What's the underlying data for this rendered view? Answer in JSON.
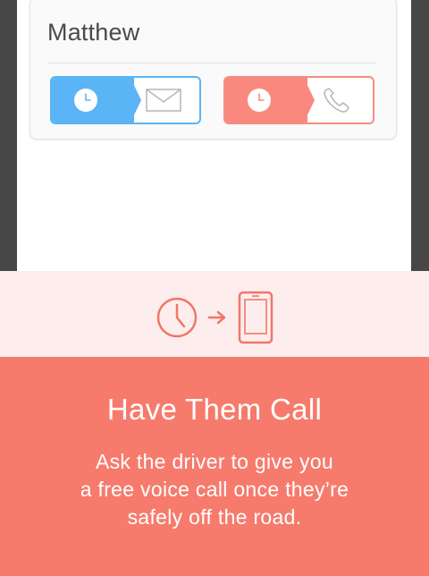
{
  "contact": {
    "name": "Matthew"
  },
  "actions": [
    {
      "label": "schedule-text",
      "icon": "envelope-icon",
      "accent": "#5ab4f5"
    },
    {
      "label": "schedule-call",
      "icon": "phone-icon",
      "accent": "#f9897f"
    }
  ],
  "promo": {
    "flow_icons": [
      "clock-icon",
      "arrow-right-icon",
      "smartphone-icon"
    ],
    "title": "Have Them Call",
    "body_lines": [
      "Ask the driver to give you",
      "a free voice call once they’re",
      "safely off the road."
    ]
  },
  "colors": {
    "text_accent": "#5ab4f5",
    "call_accent": "#f9897f",
    "panel": "#f67b6d",
    "band": "#fdeeed"
  }
}
